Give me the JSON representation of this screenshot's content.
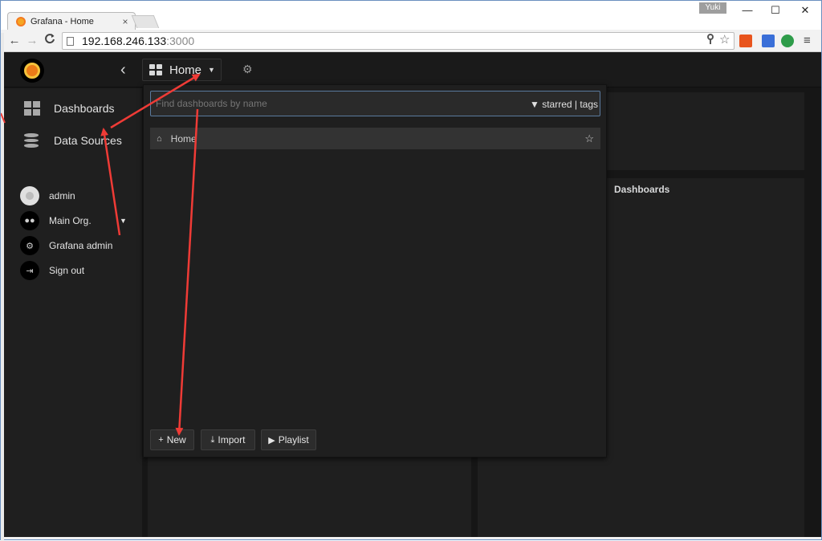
{
  "browser": {
    "tab_title": "Grafana - Home",
    "tab_close": "×",
    "user_badge": "Yuki",
    "url_host": "192.168.246.133",
    "url_port": ":3000",
    "win_min": "—",
    "win_max": "☐",
    "win_close": "✕",
    "back": "←",
    "forward": "→",
    "reload": "C",
    "key_icon": "key-icon",
    "star": "☆",
    "menu": "≡"
  },
  "topbar": {
    "collapse": "‹",
    "dashboard_title": "Home",
    "caret": "▼",
    "cog": "⚙"
  },
  "sidemenu": {
    "items": [
      {
        "label": "Dashboards",
        "icon": "dashboards-icon"
      },
      {
        "label": "Data Sources",
        "icon": "database-icon"
      }
    ],
    "user": [
      {
        "label": "admin",
        "icon": "avatar"
      },
      {
        "label": "Main Org.",
        "icon": "users-icon",
        "glyph": "●●"
      },
      {
        "label": "Grafana admin",
        "icon": "cog-icon",
        "glyph": "⚙"
      },
      {
        "label": "Sign out",
        "icon": "sign-out-icon",
        "glyph": "⇥"
      }
    ],
    "org_caret": "▼"
  },
  "search": {
    "placeholder": "Find dashboards by name",
    "filter_label": "▼ starred | tags",
    "results": [
      {
        "label": "Home",
        "icon": "home-icon",
        "glyph": "⌂",
        "star": "☆"
      }
    ],
    "buttons": {
      "new": {
        "glyph": "+",
        "label": "New"
      },
      "import": {
        "glyph": "⤓",
        "label": "Import"
      },
      "playlist": {
        "glyph": "▶",
        "label": "Playlist"
      }
    }
  },
  "panels": {
    "right_title": "Dashboards"
  },
  "colors": {
    "accent_arrow": "#ef3b36",
    "page_bg": "#161616",
    "panel_bg": "#1f1f1f",
    "grafana_orange": "#eb7b18"
  }
}
